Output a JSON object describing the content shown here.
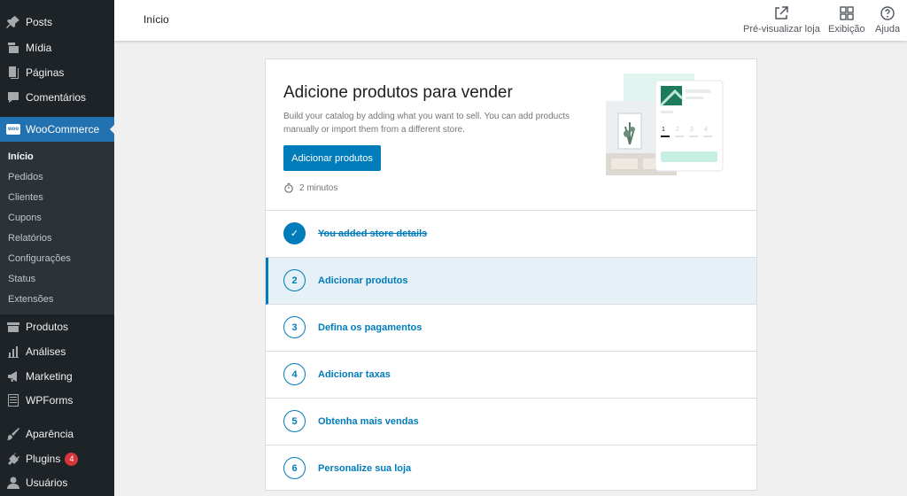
{
  "sidebar": {
    "items_top": [
      {
        "label": "Posts",
        "icon": "pin-icon"
      },
      {
        "label": "Mídia",
        "icon": "media-icon"
      },
      {
        "label": "Páginas",
        "icon": "pages-icon"
      },
      {
        "label": "Comentários",
        "icon": "comments-icon"
      }
    ],
    "woocommerce": {
      "label": "WooCommerce",
      "badge": "woo"
    },
    "submenu": [
      "Início",
      "Pedidos",
      "Clientes",
      "Cupons",
      "Relatórios",
      "Configurações",
      "Status",
      "Extensões"
    ],
    "items_bottom": [
      {
        "label": "Produtos"
      },
      {
        "label": "Análises"
      },
      {
        "label": "Marketing"
      },
      {
        "label": "WPForms"
      },
      {
        "label": "Aparência"
      },
      {
        "label": "Plugins",
        "count": "4"
      },
      {
        "label": "Usuários"
      }
    ]
  },
  "header": {
    "title": "Início",
    "preview_label": "Pré-visualizar loja",
    "display_label": "Exibição",
    "help_label": "Ajuda"
  },
  "hero": {
    "title": "Adicione produtos para vender",
    "description": "Build your catalog by adding what you want to sell. You can add products manually or import them from a different store.",
    "button_label": "Adicionar produtos",
    "time_label": "2 minutos",
    "illustration_numbers": [
      "1",
      "2",
      "3",
      "4"
    ]
  },
  "steps": [
    {
      "number": "✓",
      "label": "You added store details",
      "done": true
    },
    {
      "number": "2",
      "label": "Adicionar produtos",
      "current": true
    },
    {
      "number": "3",
      "label": "Defina os pagamentos"
    },
    {
      "number": "4",
      "label": "Adicionar taxas"
    },
    {
      "number": "5",
      "label": "Obtenha mais vendas"
    },
    {
      "number": "6",
      "label": "Personalize sua loja"
    }
  ],
  "colors": {
    "sidebar_bg": "#1d2327",
    "accent": "#2271b1",
    "primary_button": "#007cba",
    "badge_red": "#d63638"
  }
}
